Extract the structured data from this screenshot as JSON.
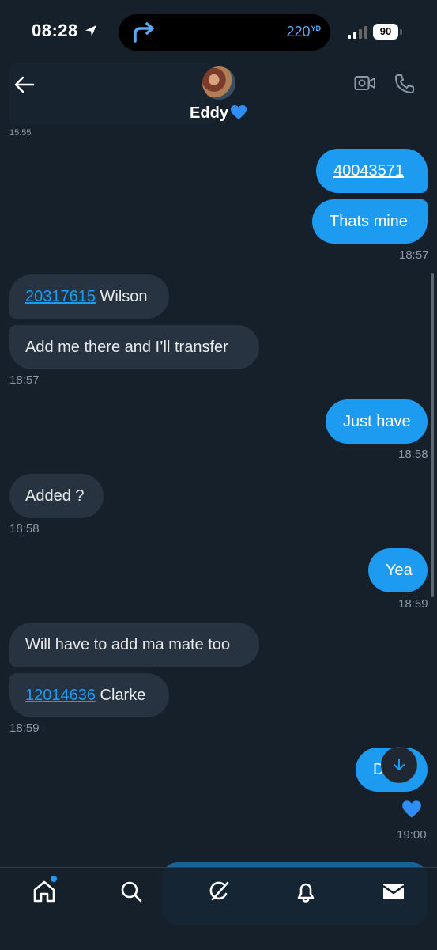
{
  "status_bar": {
    "time": "08:28",
    "yardage": "220",
    "yardage_unit": "YD",
    "battery": "90"
  },
  "header": {
    "contact_name": "Eddy"
  },
  "messages": [
    {
      "text": "40043571",
      "from": "me",
      "link": true
    },
    {
      "text": "Thats mine",
      "from": "me"
    },
    {
      "time": "18:57"
    },
    {
      "link_text": "20317615",
      "text": " Wilson",
      "from": "them"
    },
    {
      "text": "Add me there and I’ll transfer",
      "from": "them"
    },
    {
      "time": "18:57"
    },
    {
      "text": "Just have",
      "from": "me"
    },
    {
      "time": "18:58"
    },
    {
      "text": "Added ?",
      "from": "them"
    },
    {
      "time": "18:58"
    },
    {
      "text": "Yea",
      "from": "me"
    },
    {
      "time": "18:59"
    },
    {
      "text": "Will have to add ma mate too",
      "from": "them"
    },
    {
      "link_text": "12014636",
      "text": " Clarke",
      "from": "them"
    },
    {
      "time": "18:59"
    },
    {
      "text": "D",
      "from": "me"
    },
    {
      "time": "19:00"
    }
  ],
  "colors": {
    "background": "#15202b",
    "sent_bubble": "#1d9bf0",
    "received_bubble": "#273340"
  },
  "icons": [
    "location-arrow-icon",
    "turn-arrow-icon",
    "signal-icon",
    "battery-icon",
    "back-arrow-icon",
    "blue-heart-icon",
    "video-call-icon",
    "phone-icon",
    "scroll-down-icon",
    "home-icon",
    "search-icon",
    "grok-icon",
    "bell-icon",
    "mail-icon"
  ]
}
